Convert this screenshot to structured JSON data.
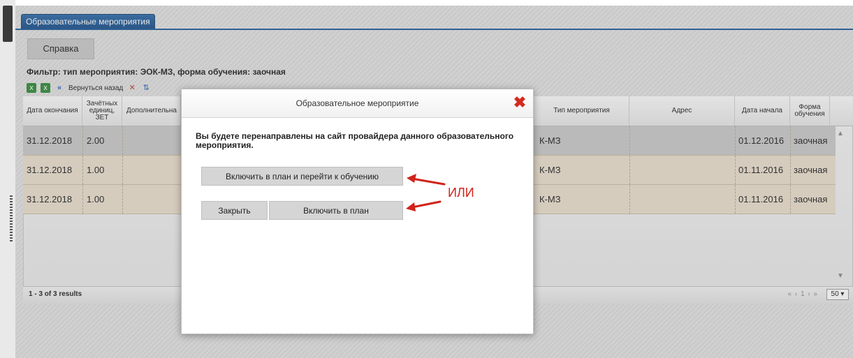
{
  "tab": {
    "label": "Образовательные мероприятия"
  },
  "toolbar": {
    "help_label": "Справка",
    "back_label": "Вернуться назад",
    "filter_text": "Фильтр: тип мероприятия: ЭОК-МЗ, форма обучения: заочная"
  },
  "table": {
    "headers": {
      "end_date": "Дата окончания",
      "credits": "Зачётных единиц, ЗЕТ",
      "additional": "Дополнительна",
      "event_type": "Тип мероприятия",
      "address": "Адрес",
      "start_date": "Дата начала",
      "study_form": "Форма обучения"
    },
    "rows": [
      {
        "end_date": "31.12.2018",
        "credits": "2.00",
        "event_type": "К-МЗ",
        "start_date": "01.12.2016",
        "study_form": "заочная"
      },
      {
        "end_date": "31.12.2018",
        "credits": "1.00",
        "event_type": "К-МЗ",
        "start_date": "01.11.2016",
        "study_form": "заочная"
      },
      {
        "end_date": "31.12.2018",
        "credits": "1.00",
        "event_type": "К-МЗ",
        "start_date": "01.11.2016",
        "study_form": "заочная"
      }
    ],
    "results": "1 - 3 of 3 results",
    "pager": "« ‹ 1 › »",
    "per_page": "50 ▾"
  },
  "modal": {
    "title": "Образовательное мероприятие",
    "message": "Вы будете перенаправлены на сайт провайдера данного образовательного мероприятия.",
    "btn_enroll_and_go": "Включить в план и перейти к обучению",
    "btn_close": "Закрыть",
    "btn_enroll": "Включить в план"
  },
  "annotation": {
    "or_label": "ИЛИ",
    "arrow_color": "#d0231a"
  }
}
